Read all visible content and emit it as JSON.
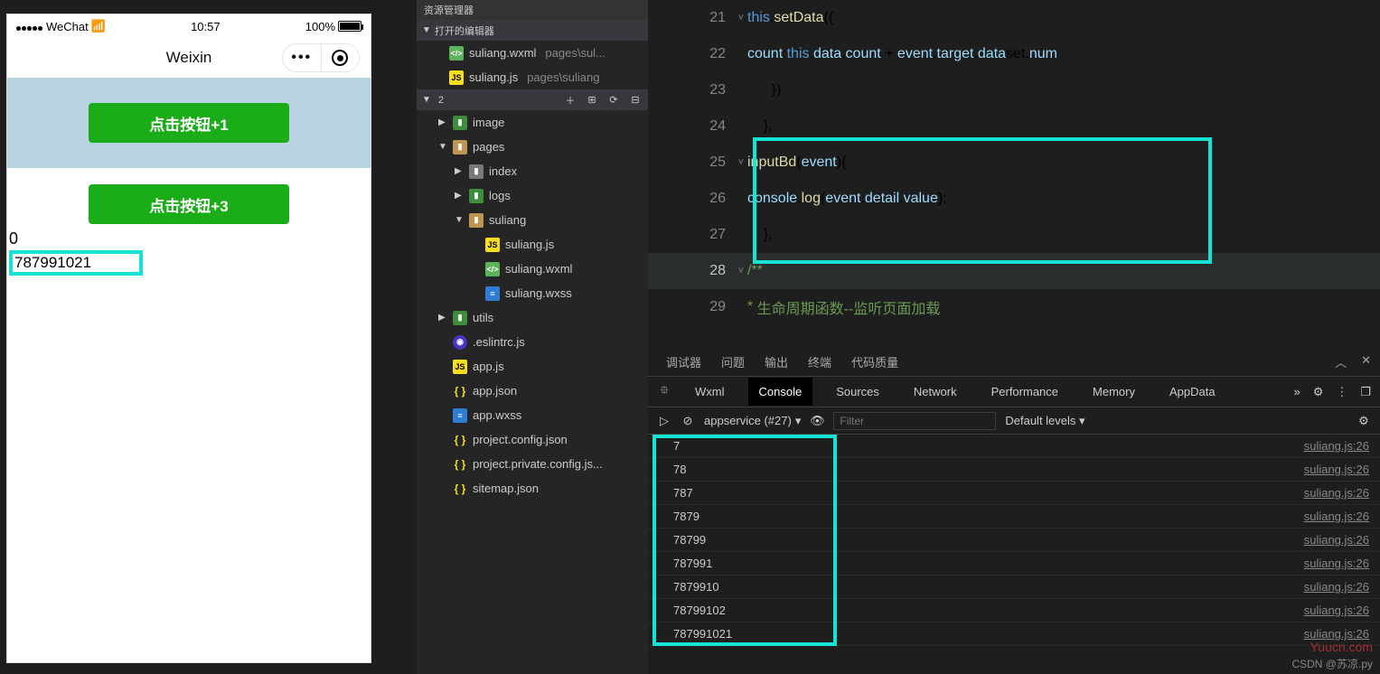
{
  "simulator": {
    "carrier": "WeChat",
    "time": "10:57",
    "battery": "100%",
    "title": "Weixin",
    "button1": "点击按钮+1",
    "button2": "点击按钮+3",
    "counter": "0",
    "inputValue": "787991021"
  },
  "explorer": {
    "header": "资源管理器",
    "openEditors": "打开的编辑器",
    "rootName": "2",
    "open": [
      {
        "icon": "wxml",
        "name": "suliang.wxml",
        "path": "pages\\sul..."
      },
      {
        "icon": "js",
        "name": "suliang.js",
        "path": "pages\\suliang"
      }
    ],
    "tree": [
      {
        "type": "folder-g",
        "name": "image",
        "chev": "▶",
        "depth": 1
      },
      {
        "type": "folder",
        "name": "pages",
        "chev": "▼",
        "depth": 1
      },
      {
        "type": "folder-d",
        "name": "index",
        "chev": "▶",
        "depth": 2
      },
      {
        "type": "folder-g",
        "name": "logs",
        "chev": "▶",
        "depth": 2
      },
      {
        "type": "folder",
        "name": "suliang",
        "chev": "▼",
        "depth": 2
      },
      {
        "type": "js",
        "name": "suliang.js",
        "depth": 3
      },
      {
        "type": "wxml",
        "name": "suliang.wxml",
        "depth": 3
      },
      {
        "type": "wxss",
        "name": "suliang.wxss",
        "depth": 3
      },
      {
        "type": "folder-g",
        "name": "utils",
        "chev": "▶",
        "depth": 1
      },
      {
        "type": "eslint",
        "name": ".eslintrc.js",
        "depth": 1
      },
      {
        "type": "js",
        "name": "app.js",
        "depth": 1
      },
      {
        "type": "json",
        "name": "app.json",
        "depth": 1
      },
      {
        "type": "wxss",
        "name": "app.wxss",
        "depth": 1
      },
      {
        "type": "json",
        "name": "project.config.json",
        "depth": 1
      },
      {
        "type": "json",
        "name": "project.private.config.js...",
        "depth": 1
      },
      {
        "type": "json",
        "name": "sitemap.json",
        "depth": 1
      }
    ]
  },
  "editor": {
    "lines": [
      21,
      22,
      23,
      24,
      25,
      26,
      27,
      28,
      29
    ],
    "activeLine": 28,
    "code": {
      "l21": "      this.setData({",
      "l22": "        count:this.data.count + event.target.dataset.num",
      "l23": "      })",
      "l24": "    },",
      "l25": "    inputBd(event){",
      "l26": "      console.log(event.detail.value);",
      "l27": "    },",
      "l28": "    /**",
      "l29": "     * 生命周期函数--监听页面加载"
    }
  },
  "debugger": {
    "topTabs": [
      "调试器",
      "问题",
      "输出",
      "终端",
      "代码质量"
    ],
    "devTabs": [
      "Wxml",
      "Console",
      "Sources",
      "Network",
      "Performance",
      "Memory",
      "AppData"
    ],
    "activeDevTab": "Console",
    "context": "appservice (#27)",
    "filterPlaceholder": "Filter",
    "levels": "Default levels",
    "logs": [
      {
        "msg": "7",
        "src": "suliang.js:26"
      },
      {
        "msg": "78",
        "src": "suliang.js:26"
      },
      {
        "msg": "787",
        "src": "suliang.js:26"
      },
      {
        "msg": "7879",
        "src": "suliang.js:26"
      },
      {
        "msg": "78799",
        "src": "suliang.js:26"
      },
      {
        "msg": "787991",
        "src": "suliang.js:26"
      },
      {
        "msg": "7879910",
        "src": "suliang.js:26"
      },
      {
        "msg": "78799102",
        "src": "suliang.js:26"
      },
      {
        "msg": "787991021",
        "src": "suliang.js:26"
      }
    ]
  },
  "watermark": "Yuucn.com",
  "credit": "CSDN @苏凉.py"
}
